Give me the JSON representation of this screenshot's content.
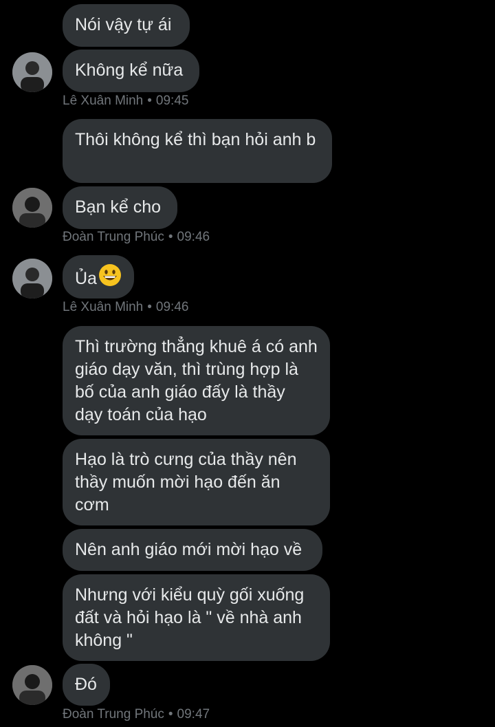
{
  "messages": [
    {
      "text": "Nói vậy tự ái"
    },
    {
      "text": "Không kể nữa"
    },
    {
      "text": "Thôi không kể thì bạn hỏi anh b"
    },
    {
      "text": "Bạn kể cho"
    },
    {
      "text": "Ủa",
      "emoji": "grinning-face-emoji"
    },
    {
      "text": "Thì trường thẳng khuê á có anh giáo dạy văn, thì trùng hợp là bố của anh giáo đấy là thầy dạy toán của hạo"
    },
    {
      "text": "Hạo là trò cưng của thầy nên thầy muốn mời hạo đến ăn cơm"
    },
    {
      "text": "Nên anh giáo mới mời hạo về"
    },
    {
      "text": "Nhưng với kiểu quỳ gối xuống đất và hỏi hạo là \" về nhà anh không \""
    },
    {
      "text": "Đó"
    }
  ],
  "meta": [
    {
      "sender": "Lê Xuân Minh",
      "time": "09:45"
    },
    {
      "sender": "Đoàn Trung Phúc",
      "time": "09:46"
    },
    {
      "sender": "Lê Xuân Minh",
      "time": "09:46"
    },
    {
      "sender": "Đoàn Trung Phúc",
      "time": "09:47"
    }
  ],
  "separator": "•",
  "colors": {
    "background": "#000000",
    "bubble": "#2f3336",
    "text": "#e7e9ea",
    "meta": "#71767b"
  }
}
